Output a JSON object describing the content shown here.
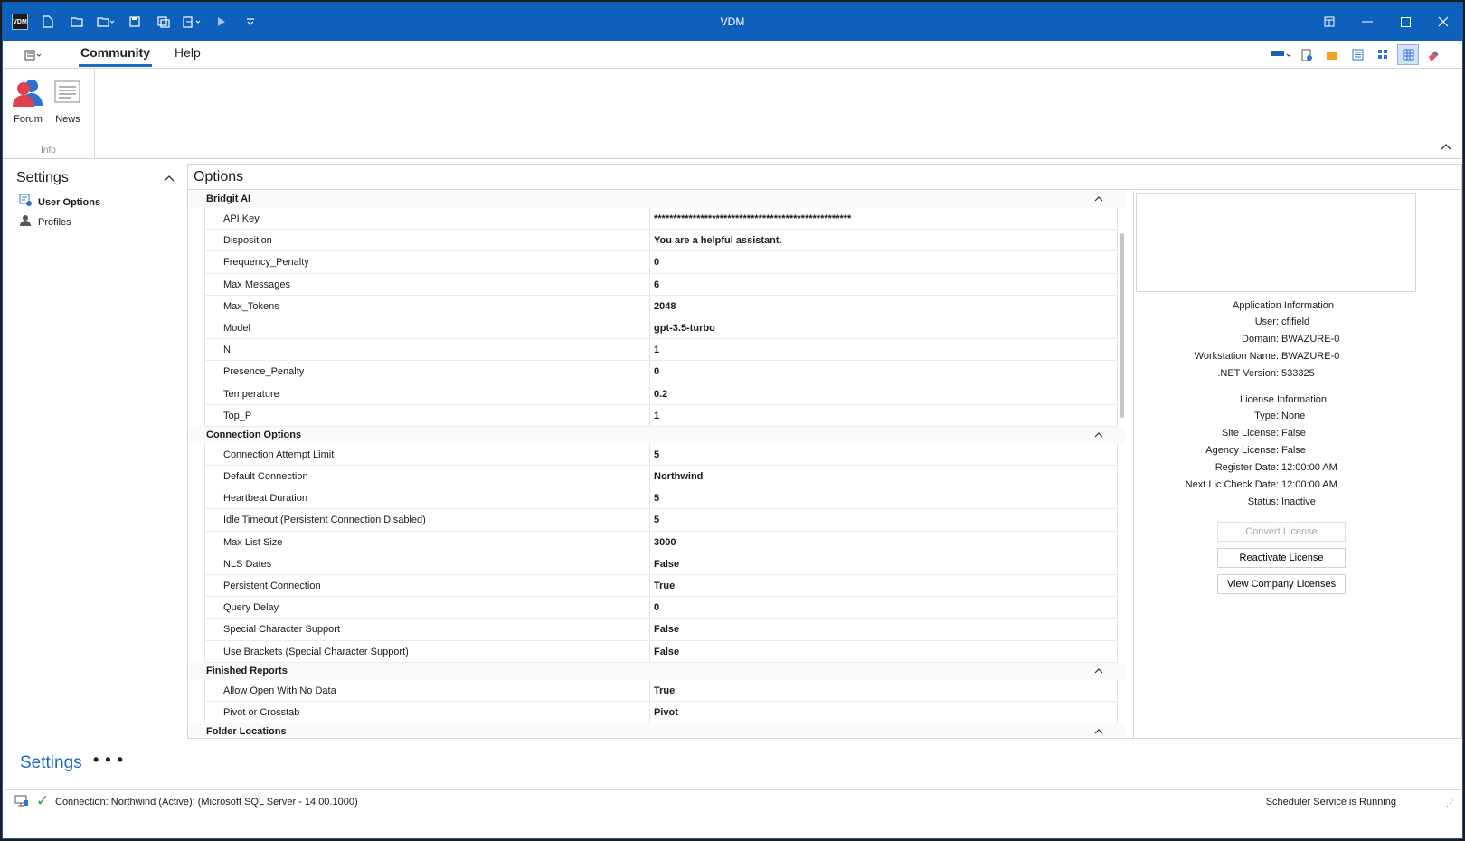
{
  "window": {
    "title": "VDM",
    "app_icon_text": "VDM"
  },
  "ribbon": {
    "tabs": [
      {
        "label": "Community",
        "active": true
      },
      {
        "label": "Help",
        "active": false
      }
    ],
    "groups": [
      {
        "label": "Info",
        "buttons": [
          {
            "label": "Forum",
            "icon": "forum-users-icon"
          },
          {
            "label": "News",
            "icon": "news-document-icon"
          }
        ]
      }
    ]
  },
  "settings_panel": {
    "title": "Settings",
    "items": [
      {
        "label": "User Options",
        "icon": "user-options-icon",
        "selected": true
      },
      {
        "label": "Profiles",
        "icon": "person-icon",
        "selected": false
      }
    ]
  },
  "options": {
    "title": "Options",
    "categories": [
      {
        "name": "Bridgit AI",
        "rows": [
          {
            "key": "API Key",
            "value": "***************************************************"
          },
          {
            "key": "Disposition",
            "value": "You are a helpful assistant."
          },
          {
            "key": "Frequency_Penalty",
            "value": "0"
          },
          {
            "key": "Max Messages",
            "value": "6"
          },
          {
            "key": "Max_Tokens",
            "value": "2048"
          },
          {
            "key": "Model",
            "value": "gpt-3.5-turbo"
          },
          {
            "key": "N",
            "value": "1"
          },
          {
            "key": "Presence_Penalty",
            "value": "0"
          },
          {
            "key": "Temperature",
            "value": "0.2"
          },
          {
            "key": "Top_P",
            "value": "1"
          }
        ]
      },
      {
        "name": "Connection Options",
        "rows": [
          {
            "key": "Connection Attempt Limit",
            "value": "5"
          },
          {
            "key": "Default Connection",
            "value": "Northwind"
          },
          {
            "key": "Heartbeat Duration",
            "value": "5"
          },
          {
            "key": "Idle Timeout (Persistent Connection Disabled)",
            "value": "5"
          },
          {
            "key": "Max List Size",
            "value": "3000"
          },
          {
            "key": "NLS Dates",
            "value": "False"
          },
          {
            "key": "Persistent Connection",
            "value": "True"
          },
          {
            "key": "Query Delay",
            "value": "0"
          },
          {
            "key": "Special Character Support",
            "value": "False"
          },
          {
            "key": "Use Brackets (Special Character Support)",
            "value": "False"
          }
        ]
      },
      {
        "name": "Finished Reports",
        "rows": [
          {
            "key": "Allow Open With No Data",
            "value": "True"
          },
          {
            "key": "Pivot or Crosstab",
            "value": "Pivot"
          }
        ]
      },
      {
        "name": "Folder Locations",
        "rows": []
      }
    ]
  },
  "info_panel": {
    "app_info_title": "Application Information",
    "app_info": [
      {
        "label": "User:",
        "value": "cfifield"
      },
      {
        "label": "Domain:",
        "value": "BWAZURE-0"
      },
      {
        "label": "Workstation Name:",
        "value": "BWAZURE-0"
      },
      {
        "label": ".NET Version:",
        "value": "533325"
      }
    ],
    "license_title": "License Information",
    "license_info": [
      {
        "label": "Type:",
        "value": "None"
      },
      {
        "label": "Site License:",
        "value": "False"
      },
      {
        "label": "Agency License:",
        "value": "False"
      },
      {
        "label": "Register Date:",
        "value": "12:00:00 AM"
      },
      {
        "label": "Next Lic Check Date:",
        "value": "12:00:00 AM"
      },
      {
        "label": "Status:",
        "value": "Inactive"
      }
    ],
    "buttons": [
      {
        "label": "Convert License",
        "disabled": true
      },
      {
        "label": "Reactivate License",
        "disabled": false
      },
      {
        "label": "View Company Licenses",
        "disabled": false
      }
    ]
  },
  "navbar": {
    "label": "Settings",
    "more": "• • •"
  },
  "status": {
    "connection": "Connection: Northwind (Active): (Microsoft SQL Server - 14.00.1000)",
    "scheduler": "Scheduler Service is Running"
  },
  "colors": {
    "titlebar": "#0f5fbd",
    "accent": "#1e66c9",
    "ok": "#2c9a3d"
  }
}
